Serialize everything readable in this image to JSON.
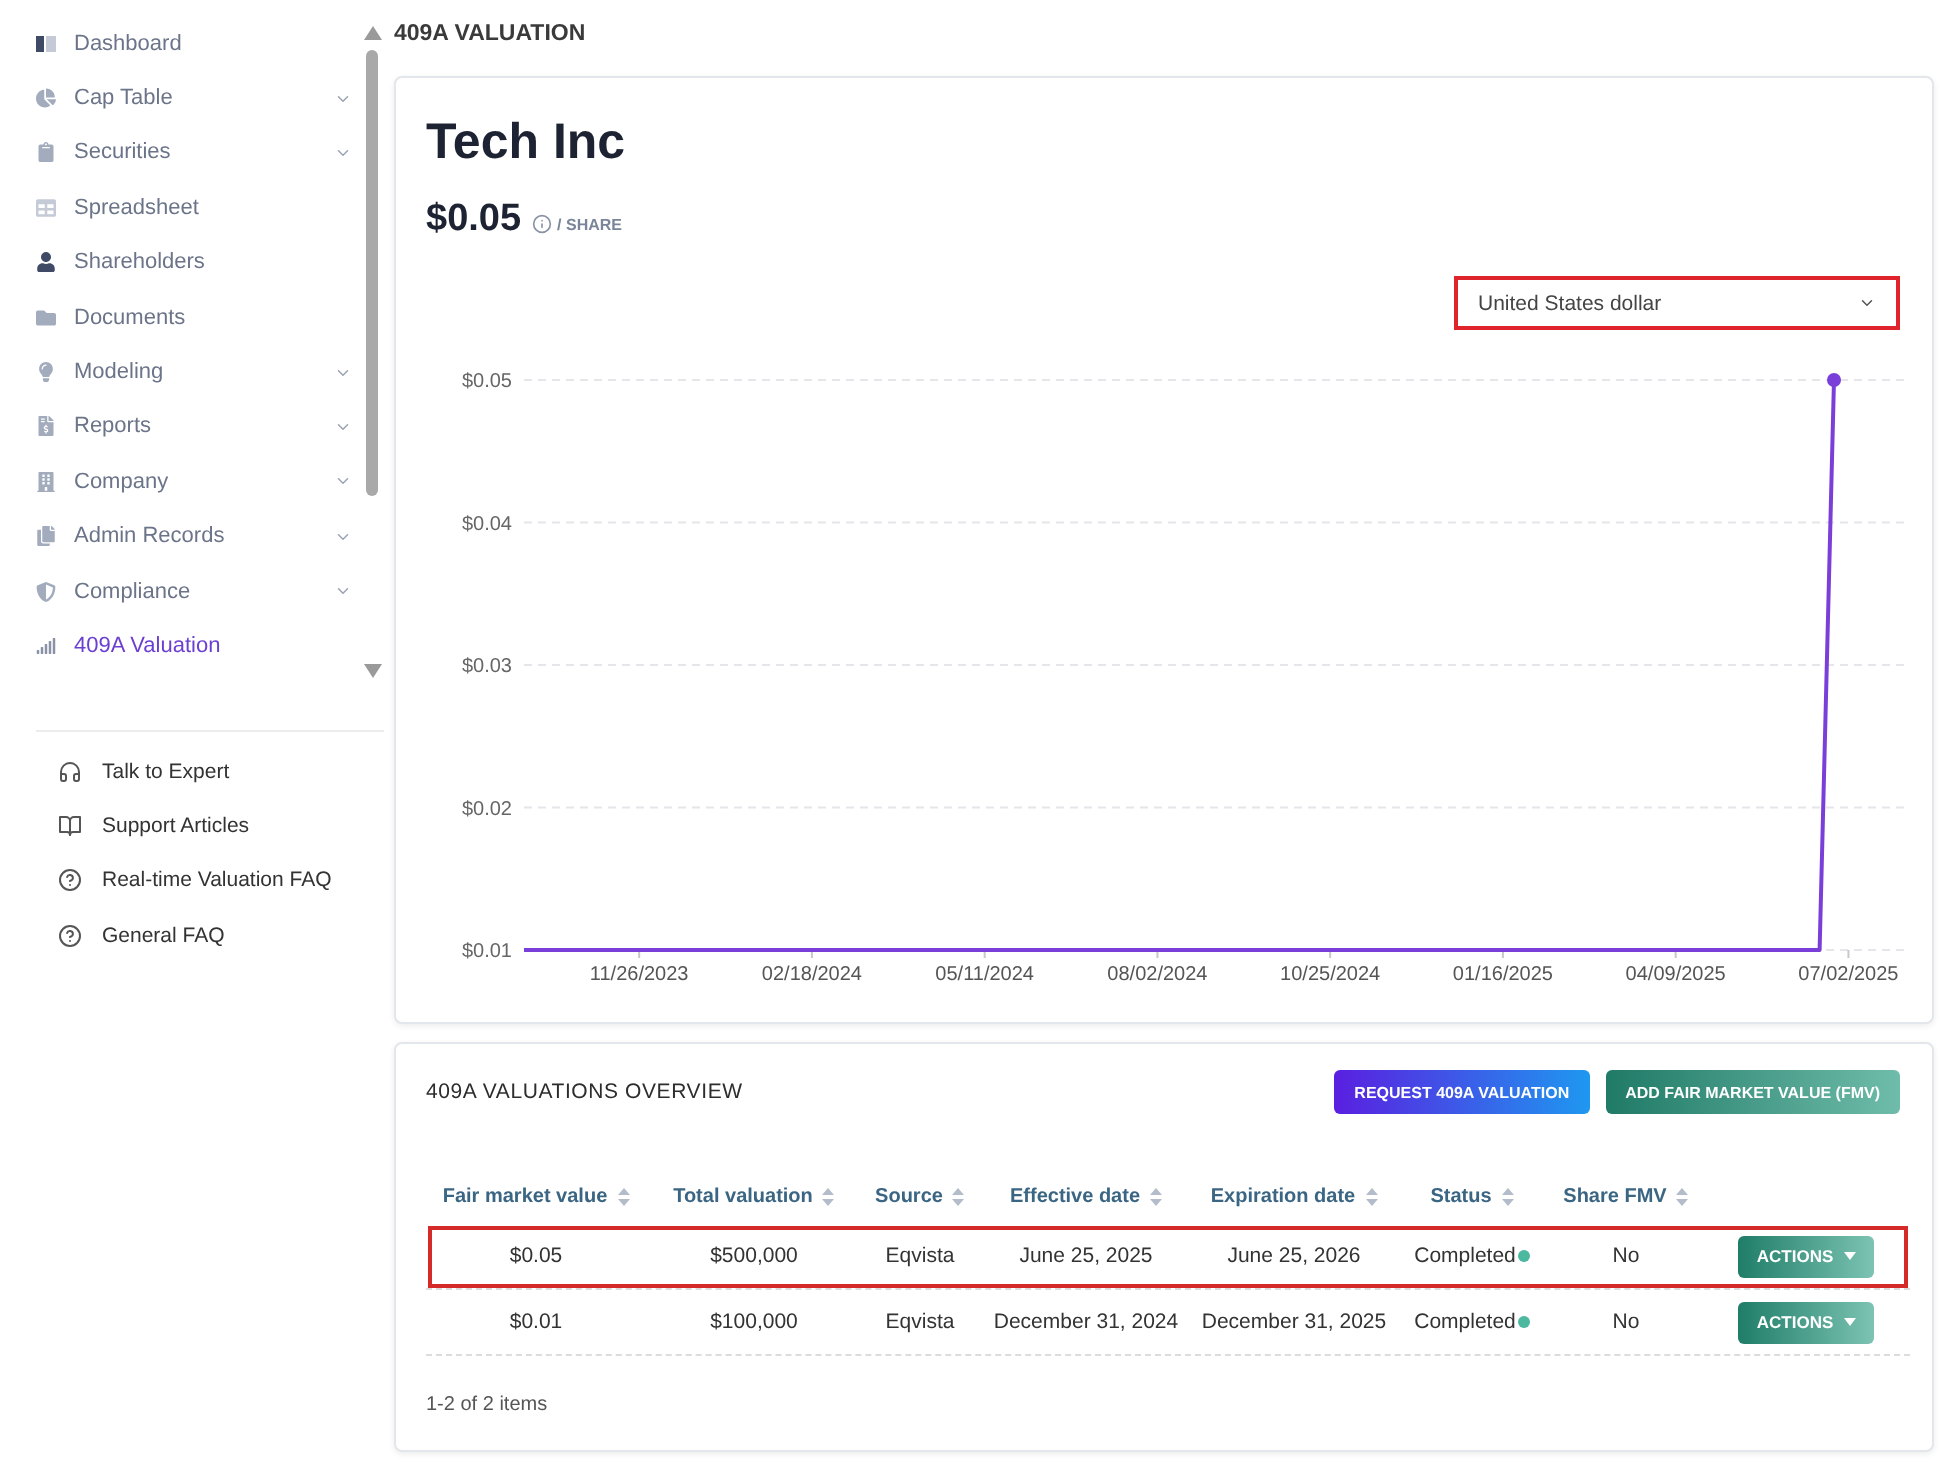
{
  "sidebar": {
    "items": [
      {
        "label": "Dashboard",
        "kind": "link",
        "selected": false
      },
      {
        "label": "Cap Table",
        "kind": "group",
        "selected": false
      },
      {
        "label": "Securities",
        "kind": "group",
        "selected": false
      },
      {
        "label": "Spreadsheet",
        "kind": "link",
        "selected": false
      },
      {
        "label": "Shareholders",
        "kind": "link",
        "selected": false
      },
      {
        "label": "Documents",
        "kind": "link",
        "selected": false
      },
      {
        "label": "Modeling",
        "kind": "group",
        "selected": false
      },
      {
        "label": "Reports",
        "kind": "group",
        "selected": false
      },
      {
        "label": "Company",
        "kind": "group",
        "selected": false
      },
      {
        "label": "Admin Records",
        "kind": "group",
        "selected": false
      },
      {
        "label": "Compliance",
        "kind": "group",
        "selected": false
      },
      {
        "label": "409A Valuation",
        "kind": "link",
        "selected": true
      }
    ],
    "help_links": [
      "Talk to Expert",
      "Support Articles",
      "Real-time Valuation FAQ",
      "General FAQ"
    ]
  },
  "page_title": "409A VALUATION",
  "summary": {
    "company": "Tech Inc",
    "price": "$0.05",
    "price_unit": "/ SHARE",
    "currency_select": {
      "value": "United States dollar",
      "highlighted": true
    },
    "chart_data": {
      "type": "line",
      "grid": true,
      "categories": [
        null,
        null,
        null,
        null,
        null,
        null,
        null,
        null,
        "11/26/2023",
        null,
        null,
        null,
        null,
        null,
        null,
        null,
        null,
        null,
        null,
        null,
        "02/18/2024",
        null,
        null,
        null,
        null,
        null,
        null,
        null,
        null,
        null,
        null,
        null,
        "05/11/2024",
        null,
        null,
        null,
        null,
        null,
        null,
        null,
        null,
        null,
        null,
        null,
        "08/02/2024",
        null,
        null,
        null,
        null,
        null,
        null,
        null,
        null,
        null,
        null,
        null,
        "10/25/2024",
        null,
        null,
        null,
        null,
        null,
        null,
        null,
        null,
        null,
        null,
        null,
        "01/16/2025",
        null,
        null,
        null,
        null,
        null,
        null,
        null,
        null,
        null,
        null,
        null,
        "04/09/2025",
        null,
        null,
        null,
        null,
        null,
        null,
        null,
        null,
        null,
        null,
        null,
        "07/02/2025",
        null,
        null,
        null,
        null
      ],
      "series": [
        {
          "color": "#7a3fd9",
          "values": [
            0.01,
            0.01,
            0.01,
            0.01,
            0.01,
            0.01,
            0.01,
            0.01,
            0.01,
            0.01,
            0.01,
            0.01,
            0.01,
            0.01,
            0.01,
            0.01,
            0.01,
            0.01,
            0.01,
            0.01,
            0.01,
            0.01,
            0.01,
            0.01,
            0.01,
            0.01,
            0.01,
            0.01,
            0.01,
            0.01,
            0.01,
            0.01,
            0.01,
            0.01,
            0.01,
            0.01,
            0.01,
            0.01,
            0.01,
            0.01,
            0.01,
            0.01,
            0.01,
            0.01,
            0.01,
            0.01,
            0.01,
            0.01,
            0.01,
            0.01,
            0.01,
            0.01,
            0.01,
            0.01,
            0.01,
            0.01,
            0.01,
            0.01,
            0.01,
            0.01,
            0.01,
            0.01,
            0.01,
            0.01,
            0.01,
            0.01,
            0.01,
            0.01,
            0.01,
            0.01,
            0.01,
            0.01,
            0.01,
            0.01,
            0.01,
            0.01,
            0.01,
            0.01,
            0.01,
            0.01,
            0.01,
            0.01,
            0.01,
            0.01,
            0.01,
            0.01,
            0.01,
            0.01,
            0.01,
            0.01,
            0.01,
            0.05,
            null,
            null,
            null,
            null,
            null
          ]
        }
      ],
      "ylim": [
        0.01,
        0.05
      ],
      "yticks": [
        {
          "value": 0.05,
          "label": "$0.05"
        },
        {
          "value": 0.04,
          "label": "$0.04"
        },
        {
          "value": 0.03,
          "label": "$0.03"
        },
        {
          "value": 0.02,
          "label": "$0.02"
        },
        {
          "value": 0.01,
          "label": "$0.01"
        }
      ]
    }
  },
  "overview": {
    "title": "409A VALUATIONS OVERVIEW",
    "buttons": [
      {
        "label": "REQUEST 409A VALUATION",
        "kind": "primary"
      },
      {
        "label": "ADD FAIR MARKET VALUE (FMV)",
        "kind": "secondary"
      }
    ],
    "table": {
      "columns": [
        {
          "label": "Fair market value",
          "sortable": true
        },
        {
          "label": "Total valuation",
          "sortable": true
        },
        {
          "label": "Source",
          "sortable": true
        },
        {
          "label": "Effective date",
          "sortable": true
        },
        {
          "label": "Expiration date",
          "sortable": true
        },
        {
          "label": "Status",
          "sortable": true
        },
        {
          "label": "Share FMV",
          "sortable": true
        }
      ],
      "rows": [
        {
          "highlighted": true,
          "cells": [
            {
              "kind": "text",
              "text": "$0.05"
            },
            {
              "kind": "text",
              "text": "$500,000"
            },
            {
              "kind": "text",
              "text": "Eqvista"
            },
            {
              "kind": "text",
              "text": "June 25, 2025"
            },
            {
              "kind": "text",
              "text": "June 25, 2026"
            },
            {
              "kind": "status",
              "text": "Completed"
            },
            {
              "kind": "text",
              "text": "No"
            },
            {
              "kind": "action",
              "text": "ACTIONS"
            }
          ]
        },
        {
          "highlighted": false,
          "cells": [
            {
              "kind": "text",
              "text": "$0.01"
            },
            {
              "kind": "text",
              "text": "$100,000"
            },
            {
              "kind": "text",
              "text": "Eqvista"
            },
            {
              "kind": "text",
              "text": "December 31, 2024"
            },
            {
              "kind": "text",
              "text": "December 31, 2025"
            },
            {
              "kind": "status",
              "text": "Completed"
            },
            {
              "kind": "text",
              "text": "No"
            },
            {
              "kind": "action",
              "text": "ACTIONS"
            }
          ]
        }
      ]
    },
    "pagination": "1-2 of 2 items"
  }
}
